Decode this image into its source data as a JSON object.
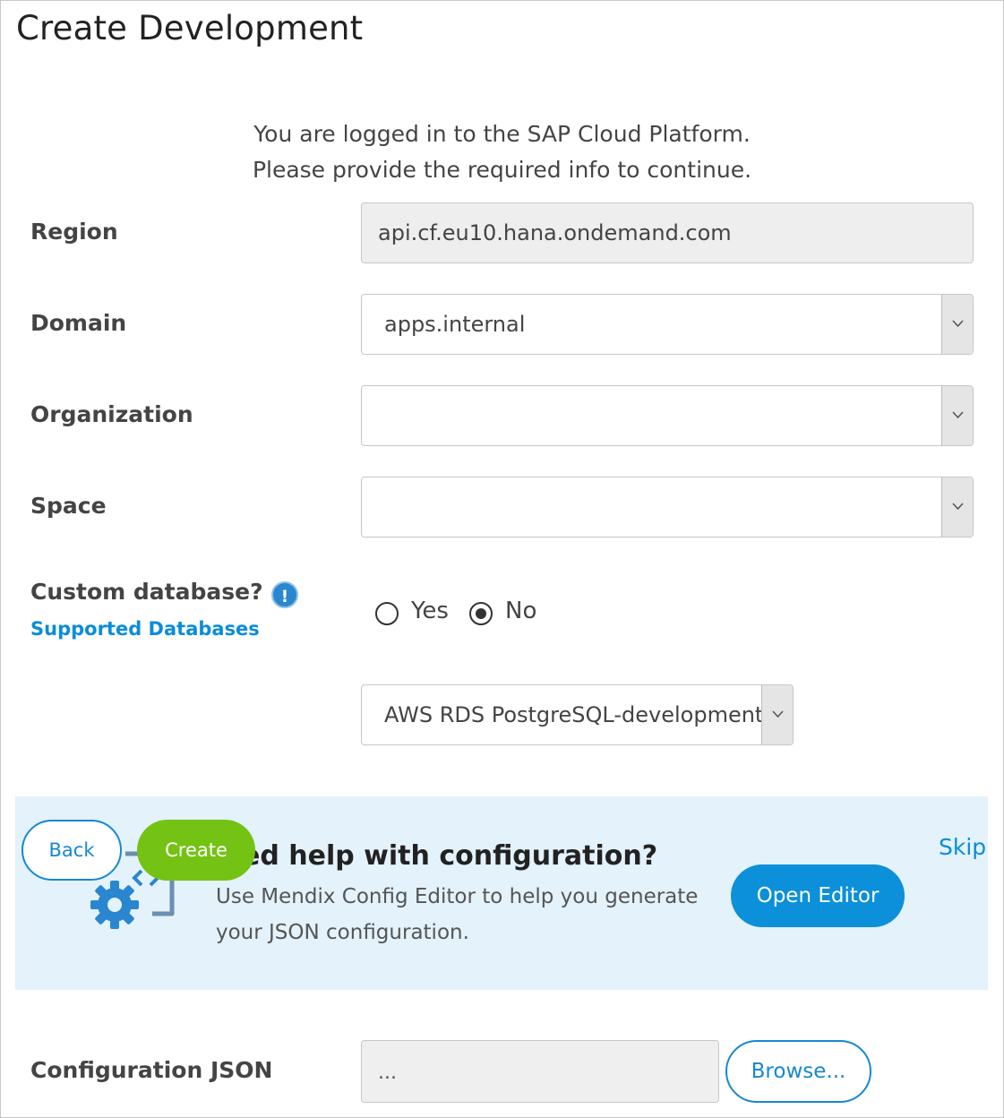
{
  "page": {
    "title": "Create Development"
  },
  "intro": {
    "line1": "You are logged in to the SAP Cloud Platform.",
    "line2": "Please provide the required info to continue."
  },
  "form": {
    "region": {
      "label": "Region",
      "value": "api.cf.eu10.hana.ondemand.com"
    },
    "domain": {
      "label": "Domain",
      "value": "apps.internal"
    },
    "organization": {
      "label": "Organization",
      "value": ""
    },
    "space": {
      "label": "Space",
      "value": ""
    },
    "custom_database": {
      "label": "Custom database?",
      "info_icon": "exclamation-info-icon",
      "link": "Supported Databases",
      "options": [
        "Yes",
        "No"
      ],
      "selected": "No"
    },
    "database_plan": {
      "value": "AWS RDS PostgreSQL-development"
    },
    "config_json": {
      "label": "Configuration JSON",
      "value": "...",
      "browse_label": "Browse..."
    }
  },
  "banner": {
    "title": "Need help with configuration?",
    "title_visible": "ed help with configuration?",
    "text": "Use Mendix Config Editor to help you generate your JSON configuration.",
    "open_editor_label": "Open Editor",
    "skip_label": "Skip",
    "illustration_icon": "config-gear-icon"
  },
  "footer_buttons": {
    "back_label": "Back",
    "create_label": "Create"
  },
  "colors": {
    "accent_blue": "#0b90d9",
    "create_green": "#74c214",
    "banner_bg": "#e3f2fb",
    "readonly_bg": "#eeeeee"
  }
}
